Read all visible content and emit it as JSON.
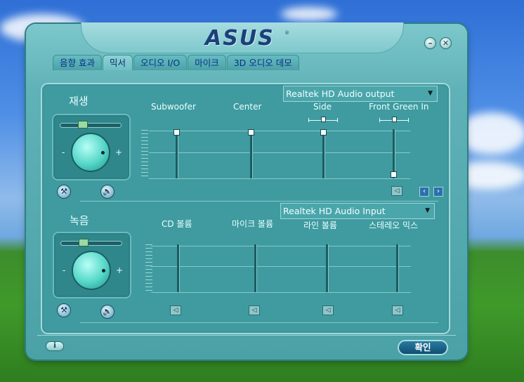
{
  "app": {
    "logo": "ASUS",
    "logo_mark": "®"
  },
  "window_buttons": {
    "minimize": "–",
    "close": "✕"
  },
  "tabs": [
    {
      "label": "음향 효과"
    },
    {
      "label": "믹서"
    },
    {
      "label": "오디오 I/O"
    },
    {
      "label": "마이크"
    },
    {
      "label": "3D 오디오 데모"
    }
  ],
  "active_tab": "믹서",
  "playback": {
    "title": "재생",
    "device": "Realtek HD Audio output",
    "knob_minus": "-",
    "knob_plus": "+",
    "channels": [
      {
        "label": "Subwoofer",
        "level": 0.95
      },
      {
        "label": "Center",
        "level": 0.95
      },
      {
        "label": "Side",
        "level": 0.95
      },
      {
        "label": "Front Green In",
        "level": 0.05
      }
    ]
  },
  "recording": {
    "title": "녹음",
    "device": "Realtek HD Audio Input",
    "knob_minus": "-",
    "knob_plus": "+",
    "channels": [
      {
        "label": "CD 볼륨"
      },
      {
        "label": "마이크 볼륨"
      },
      {
        "label": "라인 볼륨"
      },
      {
        "label": "스테레오 믹스"
      }
    ]
  },
  "footer": {
    "info": "i",
    "ok": "확인"
  },
  "icons": {
    "wrench": "wrench-icon",
    "speaker": "speaker-icon",
    "nav_left": "‹",
    "nav_right": "›"
  }
}
